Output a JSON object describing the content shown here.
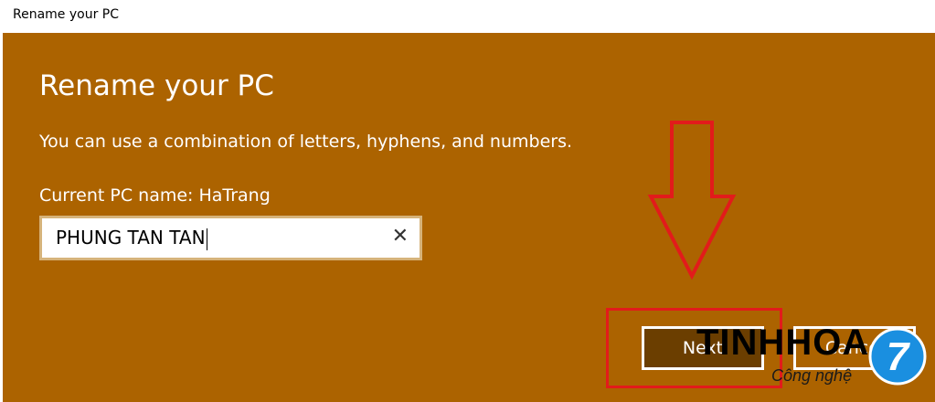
{
  "window": {
    "title": "Rename your PC"
  },
  "dialog": {
    "heading": "Rename your PC",
    "description": "You can use a combination of letters, hyphens, and numbers.",
    "current_name_label": "Current PC name: HaTrang",
    "input": {
      "value": "PHUNG TAN TAN",
      "clear_icon": "close-icon"
    },
    "buttons": {
      "next": "Next",
      "cancel": "Cancel"
    }
  },
  "annotations": {
    "arrow_color": "#e21b1b",
    "box_color": "#e21b1b"
  },
  "watermark": {
    "brand": "TINHHOA",
    "tagline": "Công nghệ",
    "logo_number": "7"
  },
  "colors": {
    "dialog_bg": "#ac6300",
    "next_bg": "#6b3e00",
    "logo_blue": "#1a8fe0"
  }
}
